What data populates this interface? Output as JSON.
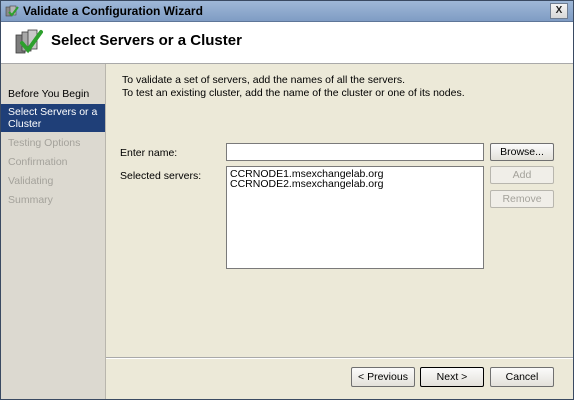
{
  "window": {
    "title": "Validate a Configuration Wizard",
    "close_symbol": "X"
  },
  "header": {
    "title": "Select Servers or a Cluster"
  },
  "sidebar": {
    "steps": [
      {
        "label": "Before You Begin",
        "state": "done"
      },
      {
        "label": "Select Servers or a",
        "label2": "Cluster",
        "state": "active"
      },
      {
        "label": "Testing Options",
        "state": "disabled"
      },
      {
        "label": "Confirmation",
        "state": "disabled"
      },
      {
        "label": "Validating",
        "state": "disabled"
      },
      {
        "label": "Summary",
        "state": "disabled"
      }
    ]
  },
  "content": {
    "instruction_1": "To validate a set of servers, add the names of all the servers.",
    "instruction_2": "To test an existing cluster, add the name of the cluster or one of its nodes.",
    "enter_name_label": "Enter name:",
    "enter_name_value": "",
    "selected_servers_label": "Selected servers:",
    "selected_servers": [
      "CCRNODE1.msexchangelab.org",
      "CCRNODE2.msexchangelab.org"
    ],
    "browse_label": "Browse...",
    "add_label": "Add",
    "remove_label": "Remove"
  },
  "footer": {
    "previous_label": "< Previous",
    "next_label": "Next >",
    "cancel_label": "Cancel"
  },
  "colors": {
    "active_step": "#1f3f78",
    "disabled_text": "#a4a29b"
  }
}
